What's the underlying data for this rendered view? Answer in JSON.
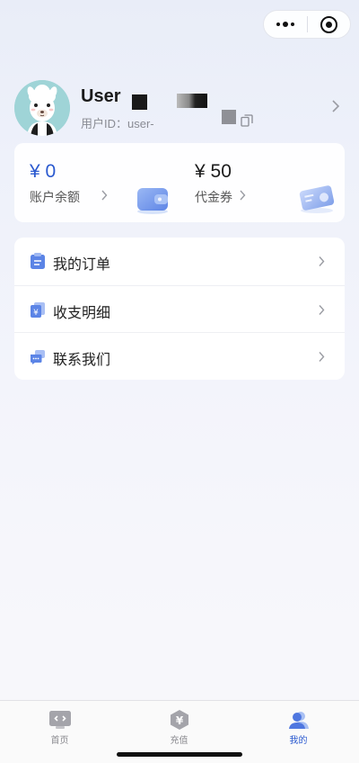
{
  "header": {
    "menu_button": "more-dots",
    "close_button": "target-circle"
  },
  "profile": {
    "name": "User",
    "id_label": "用户ID：user-"
  },
  "wallet": {
    "balance": {
      "amount": "¥ 0",
      "label": "账户余额"
    },
    "voucher": {
      "amount": "¥ 50",
      "label": "代金券"
    }
  },
  "menu": {
    "items": [
      {
        "label": "我的订单",
        "icon": "clipboard-icon"
      },
      {
        "label": "收支明细",
        "icon": "yuan-document-icon"
      },
      {
        "label": "联系我们",
        "icon": "chat-bubbles-icon"
      }
    ]
  },
  "tabbar": {
    "items": [
      {
        "label": "首页",
        "icon": "monitor-code-icon"
      },
      {
        "label": "充值",
        "icon": "yuan-hexagon-icon"
      },
      {
        "label": "我的",
        "icon": "user-icon",
        "active": true
      }
    ]
  },
  "colors": {
    "accent": "#2a59cf",
    "text": "#222222",
    "muted": "#8a8c94"
  }
}
